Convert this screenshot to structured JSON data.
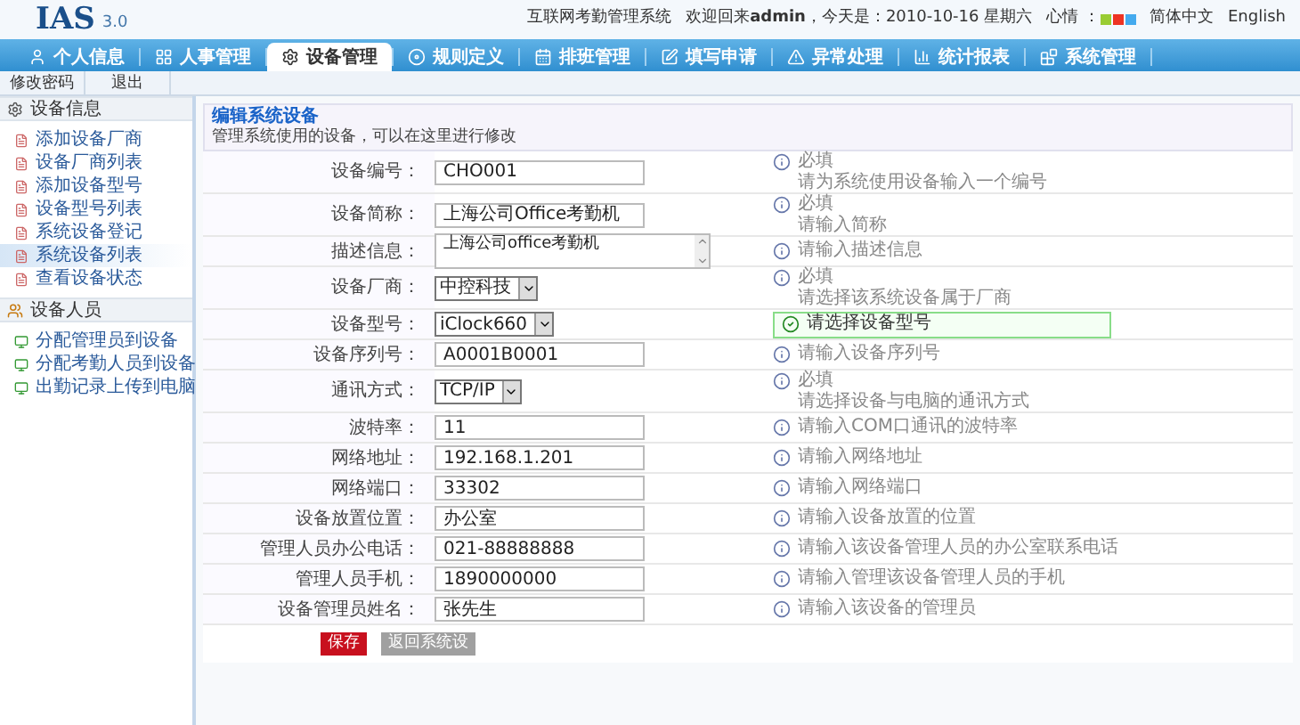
{
  "header": {
    "logo": "IAS",
    "version": "3.0",
    "system_name": "互联网考勤管理系统",
    "welcome": "欢迎回来**admin**，今天是：2010-10-16 星期六",
    "mood_label": "心情 ：",
    "moods": [
      {
        "color": "#99cc33"
      },
      {
        "color": "#ee3322"
      },
      {
        "color": "#44aaee"
      }
    ],
    "languages": [
      "简体中文",
      "English"
    ]
  },
  "nav": [
    {
      "label": "个人信息",
      "selected": false
    },
    {
      "label": "人事管理",
      "selected": false
    },
    {
      "label": "设备管理",
      "selected": true
    },
    {
      "label": "规则定义",
      "selected": false
    },
    {
      "label": "排班管理",
      "selected": false
    },
    {
      "label": "填写申请",
      "selected": false
    },
    {
      "label": "异常处理",
      "selected": false
    },
    {
      "label": "统计报表",
      "selected": false
    },
    {
      "label": "系统管理",
      "selected": false
    }
  ],
  "subnav": [
    "修改密码",
    "退出"
  ],
  "sidebar": [
    {
      "title": "设备信息",
      "items": [
        {
          "label": "添加设备厂商",
          "selected": false
        },
        {
          "label": "设备厂商列表",
          "selected": false
        },
        {
          "label": "添加设备型号",
          "selected": false
        },
        {
          "label": "设备型号列表",
          "selected": false
        },
        {
          "label": "系统设备登记",
          "selected": false
        },
        {
          "label": "系统设备列表",
          "selected": true
        },
        {
          "label": "查看设备状态",
          "selected": false
        }
      ]
    },
    {
      "title": "设备人员",
      "items": [
        {
          "label": "分配管理员到设备",
          "selected": false
        },
        {
          "label": "分配考勤人员到设备",
          "selected": false
        },
        {
          "label": "出勤记录上传到电脑",
          "selected": false
        }
      ]
    }
  ],
  "form": {
    "title": "编辑系统设备",
    "subtitle": "管理系统使用的设备，可以在这里进行修改",
    "fields": [
      {
        "label": "设备编号：",
        "kind": "text",
        "value": "CHO001",
        "hint": {
          "kind": "info",
          "lines": [
            "必填",
            "请为系统使用设备输入一个编号"
          ]
        }
      },
      {
        "label": "设备简称：",
        "kind": "text",
        "value": "上海公司Office考勤机",
        "hint": {
          "kind": "info",
          "lines": [
            "必填",
            "请输入简称"
          ]
        }
      },
      {
        "label": "描述信息：",
        "kind": "textarea",
        "value": "上海公司office考勤机",
        "hint": {
          "kind": "info",
          "lines": [
            "请输入描述信息"
          ]
        }
      },
      {
        "label": "设备厂商：",
        "kind": "select",
        "value": "中控科技",
        "hint": {
          "kind": "info",
          "lines": [
            "必填",
            "请选择该系统设备属于厂商"
          ]
        }
      },
      {
        "label": "设备型号：",
        "kind": "select",
        "value": "iClock660",
        "hint": {
          "kind": "ok",
          "lines": [
            "请选择设备型号"
          ]
        }
      },
      {
        "label": "设备序列号：",
        "kind": "text",
        "value": "A0001B0001",
        "hint": {
          "kind": "info",
          "lines": [
            "请输入设备序列号"
          ]
        }
      },
      {
        "label": "通讯方式：",
        "kind": "select",
        "value": "TCP/IP",
        "hint": {
          "kind": "info",
          "lines": [
            "必填",
            "请选择设备与电脑的通讯方式"
          ]
        }
      },
      {
        "label": "波特率：",
        "kind": "text",
        "value": "11",
        "hint": {
          "kind": "info",
          "lines": [
            "请输入COM口通讯的波特率"
          ]
        }
      },
      {
        "label": "网络地址：",
        "kind": "text",
        "value": "192.168.1.201",
        "hint": {
          "kind": "info",
          "lines": [
            "请输入网络地址"
          ]
        }
      },
      {
        "label": "网络端口：",
        "kind": "text",
        "value": "33302",
        "hint": {
          "kind": "info",
          "lines": [
            "请输入网络端口"
          ]
        }
      },
      {
        "label": "设备放置位置：",
        "kind": "text",
        "value": "办公室",
        "hint": {
          "kind": "info",
          "lines": [
            "请输入设备放置的位置"
          ]
        }
      },
      {
        "label": "管理人员办公电话：",
        "kind": "text",
        "value": "021-88888888",
        "hint": {
          "kind": "info",
          "lines": [
            "请输入该设备管理人员的办公室联系电话"
          ]
        }
      },
      {
        "label": "管理人员手机：",
        "kind": "text",
        "value": "1890000000",
        "hint": {
          "kind": "info",
          "lines": [
            "请输入管理该设备管理人员的手机"
          ]
        }
      },
      {
        "label": "设备管理员姓名：",
        "kind": "text",
        "value": "张先生",
        "hint": {
          "kind": "info",
          "lines": [
            "请输入该设备的管理员"
          ]
        }
      }
    ],
    "buttons": [
      {
        "label": "保存",
        "kind": "primary"
      },
      {
        "label": "返回系统设",
        "kind": "secondary"
      }
    ]
  }
}
